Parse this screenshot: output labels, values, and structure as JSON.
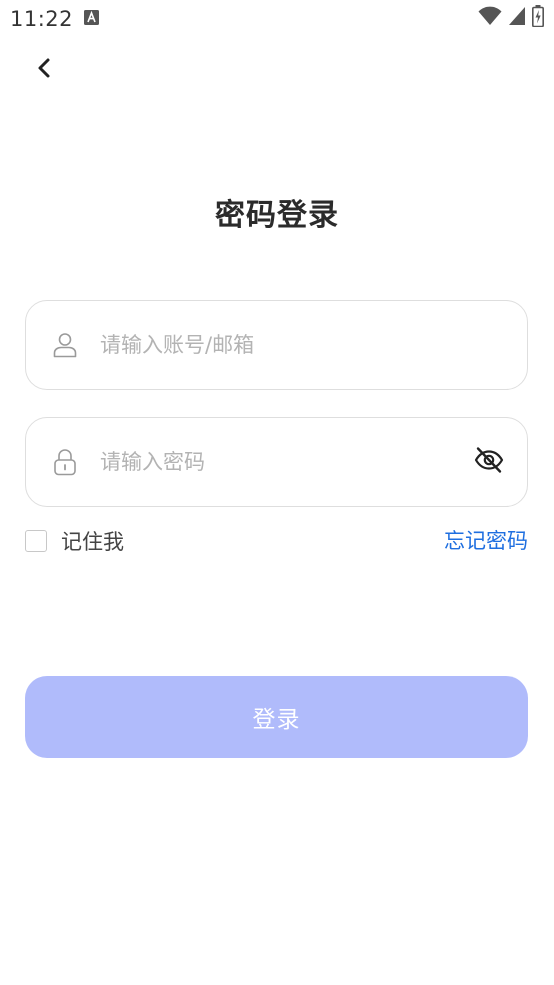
{
  "status_bar": {
    "time": "11:22",
    "notification_icon": "a-notification-icon",
    "wifi_icon": "wifi-icon",
    "signal_icon": "signal-icon",
    "battery_icon": "battery-charging-icon"
  },
  "header": {
    "back_icon": "chevron-left-icon"
  },
  "page": {
    "title": "密码登录"
  },
  "form": {
    "account": {
      "icon": "user-icon",
      "placeholder": "请输入账号/邮箱",
      "value": ""
    },
    "password": {
      "icon": "lock-icon",
      "placeholder": "请输入密码",
      "value": "",
      "visibility_icon": "eye-off-icon"
    },
    "remember_label": "记住我",
    "remember_checked": false,
    "forgot_label": "忘记密码",
    "submit_label": "登录"
  },
  "colors": {
    "link": "#1f6fe0",
    "primary_button_disabled": "#b0bbfb",
    "field_border": "#dedede",
    "title": "#2b2b2b"
  }
}
